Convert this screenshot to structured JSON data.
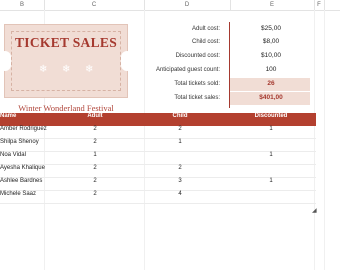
{
  "columns": [
    "B",
    "C",
    "D",
    "E",
    "F"
  ],
  "ticket": {
    "title": "TICKET SALES",
    "subtitle": "Winter Wonderland Festival",
    "snowflake": "❄"
  },
  "summary": [
    {
      "label": "Adult cost:",
      "value": "$25,00",
      "highlight": false
    },
    {
      "label": "Child cost:",
      "value": "$8,00",
      "highlight": false
    },
    {
      "label": "Discounted cost:",
      "value": "$10,00",
      "highlight": false
    },
    {
      "label": "Anticipated guest count:",
      "value": "100",
      "highlight": false
    },
    {
      "label": "Total tickets sold:",
      "value": "26",
      "highlight": true
    },
    {
      "label": "Total ticket sales:",
      "value": "$401,00",
      "highlight": true
    }
  ],
  "table": {
    "headers": {
      "name": "Name",
      "adult": "Adult",
      "child": "Child",
      "discounted": "Discounted"
    },
    "rows": [
      {
        "name": "Amber Rodriguez",
        "adult": "2",
        "child": "2",
        "discounted": "1"
      },
      {
        "name": "Shilpa Shenoy",
        "adult": "2",
        "child": "1",
        "discounted": ""
      },
      {
        "name": "Noa Vidal",
        "adult": "1",
        "child": "",
        "discounted": "1"
      },
      {
        "name": "Ayesha Khalique",
        "adult": "2",
        "child": "2",
        "discounted": ""
      },
      {
        "name": "Ashlee Bardnes",
        "adult": "2",
        "child": "3",
        "discounted": "1"
      },
      {
        "name": "Michele Saaz",
        "adult": "2",
        "child": "4",
        "discounted": ""
      }
    ]
  },
  "colors": {
    "accent": "#b3402f",
    "ticket_bg": "#f1ddd5"
  }
}
